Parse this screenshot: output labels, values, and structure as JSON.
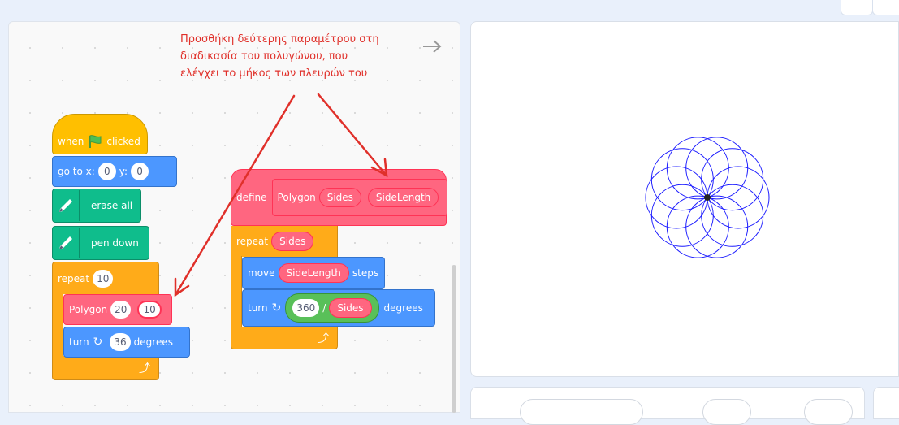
{
  "annotation": {
    "lines": [
      "Προσθήκη δεύτερης παραμέτρου στη",
      "διαδικασία του πολυγώνου, που",
      "ελέγχει το μήκος των πλευρών του"
    ],
    "color": "#e0302a"
  },
  "main_script": {
    "hat": {
      "when": "when",
      "clicked": "clicked"
    },
    "goto": {
      "label_x": "go to x:",
      "x": "0",
      "label_y": "y:",
      "y": "0"
    },
    "erase": "erase all",
    "pen_down": "pen down",
    "repeat": {
      "label": "repeat",
      "count": "10"
    },
    "polygon_call": {
      "label": "Polygon",
      "arg1": "20",
      "arg2": "10"
    },
    "turn": {
      "label": "turn",
      "value": "36",
      "unit": "degrees"
    }
  },
  "define_script": {
    "define": {
      "label": "define",
      "name": "Polygon",
      "param1": "Sides",
      "param2": "SideLength"
    },
    "repeat": {
      "label": "repeat",
      "count": "Sides"
    },
    "move": {
      "label": "move",
      "arg": "SideLength",
      "unit": "steps"
    },
    "turn": {
      "label": "turn",
      "num": "360",
      "op": "/",
      "den": "Sides",
      "unit": "degrees"
    }
  },
  "stage": {
    "drawing": "polygon-rosette",
    "circles": 10,
    "pen_color": "#1a1aff"
  },
  "colors": {
    "motion": "#4c97ff",
    "pen": "#0fbd8c",
    "events": "#ffbf00",
    "control": "#ffab19",
    "myblocks": "#ff6680",
    "operators": "#59c059"
  }
}
